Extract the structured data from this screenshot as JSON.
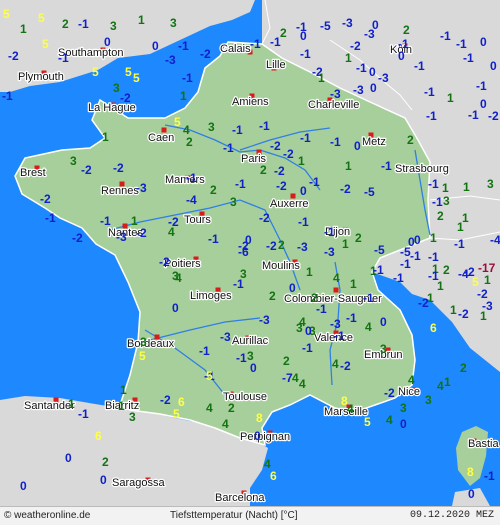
{
  "colors": {
    "sea": "#1e88ff",
    "neighbor_land": "#d9d9d9",
    "france_land": "#a7cf9b",
    "border": "#ffffff",
    "river": "#2f7fe6",
    "cold": "#1020c8",
    "warm": "#137313",
    "pos_high": "#ffff44",
    "very_cold": "#9a0f3a",
    "city": "#d81b1b"
  },
  "cities": [
    "Southampton",
    "Plymouth",
    "Calais",
    "Lille",
    "Köln",
    "Amiens",
    "Charleville",
    "La Hague",
    "Caen",
    "Metz",
    "Paris",
    "Brest",
    "Strasbourg",
    "Mamers",
    "Rennes",
    "Auxerre",
    "Tours",
    "Nantes",
    "Dijon",
    "Poitiers",
    "Moulins",
    "Limoges",
    "Colombier-Saugnier",
    "Bordeaux",
    "Aurillac",
    "Valence",
    "Embrun",
    "Santander",
    "Biarritz",
    "Toulouse",
    "Nice",
    "Marseille",
    "Perpignan",
    "Bastia",
    "Saragossa",
    "Barcelona"
  ],
  "temperatures": [
    "5",
    "5",
    "1",
    "2",
    "1",
    "3",
    "2",
    "-1",
    "0",
    "-5",
    "-3",
    "0",
    "2",
    "3",
    "-1",
    "-2",
    "-1",
    "-1",
    "0",
    "-1",
    "-2",
    "1",
    "5",
    "0",
    "-3",
    "-1",
    "-1",
    "-2",
    "-3",
    "-1",
    "-1",
    "-1",
    "0",
    "-1",
    "1",
    "0",
    "-1",
    "-2",
    "-1",
    "1",
    "0",
    "-1",
    "0",
    "-1",
    "-3",
    "0",
    "-1",
    "-3",
    "5",
    "-1",
    "-3",
    "0",
    "-1",
    "1",
    "-2",
    "5",
    "3",
    "5",
    "-2",
    "-1",
    "2",
    "1",
    "5",
    "4",
    "2",
    "3",
    "-1",
    "-1",
    "-1",
    "-2",
    "-2",
    "1",
    "2",
    "-1",
    "-1",
    "-1",
    "0",
    "-2",
    "-1",
    "1",
    "-1",
    "-1",
    "-1",
    "3",
    "3",
    "-2",
    "-2",
    "-3",
    "-4",
    "-1",
    "-2",
    "0",
    "-2",
    "-5",
    "1",
    "1",
    "3",
    "-2",
    "-1",
    "-1",
    "1",
    "2",
    "3",
    "-2",
    "-1",
    "-2",
    "-1",
    "-1",
    "2",
    "2",
    "1",
    "1",
    "1",
    "-1",
    "0",
    "-5",
    "-1",
    "0",
    "-4",
    "-2",
    "-3",
    "-2",
    "-2",
    "-2",
    "-2",
    "-6",
    "0",
    "2",
    "-3",
    "-3",
    "1",
    "1",
    "-5",
    "-1",
    "1",
    "-4",
    "-17",
    "-2",
    "1",
    "-1",
    "1",
    "2",
    "-2",
    "-3",
    "-2",
    "-1",
    "1",
    "5",
    "1",
    "1",
    "-1",
    "2",
    "3",
    "4",
    "-1",
    "-1",
    "4",
    "3",
    "0",
    "-1",
    "-2",
    "1",
    "1",
    "-3",
    "0",
    "4",
    "-3",
    "3",
    "0",
    "-1",
    "3",
    "-1",
    "3",
    "4",
    "5",
    "-1",
    "3",
    "-1",
    "4",
    "-7",
    "4",
    "2",
    "4",
    "3",
    "4",
    "6",
    "2",
    "4",
    "-2",
    "4",
    "5",
    "6",
    "4",
    "5",
    "3",
    "2",
    "4",
    "8",
    "0",
    "1",
    "8",
    "4",
    "4",
    "5",
    "4",
    "3",
    "3",
    "1",
    "-2",
    "6",
    "6",
    "8",
    "-1",
    "0",
    "0",
    "0",
    "0",
    "1",
    "0",
    "-1",
    "2",
    "-1",
    "-3",
    "-1",
    "0",
    "-2",
    "0",
    "-1",
    "1",
    "2"
  ],
  "footer": {
    "source": "© weatheronline.de",
    "title": "Tiefsttemperatur (Nacht) [°C]",
    "datetime": "09.12.2020 MEZ"
  }
}
